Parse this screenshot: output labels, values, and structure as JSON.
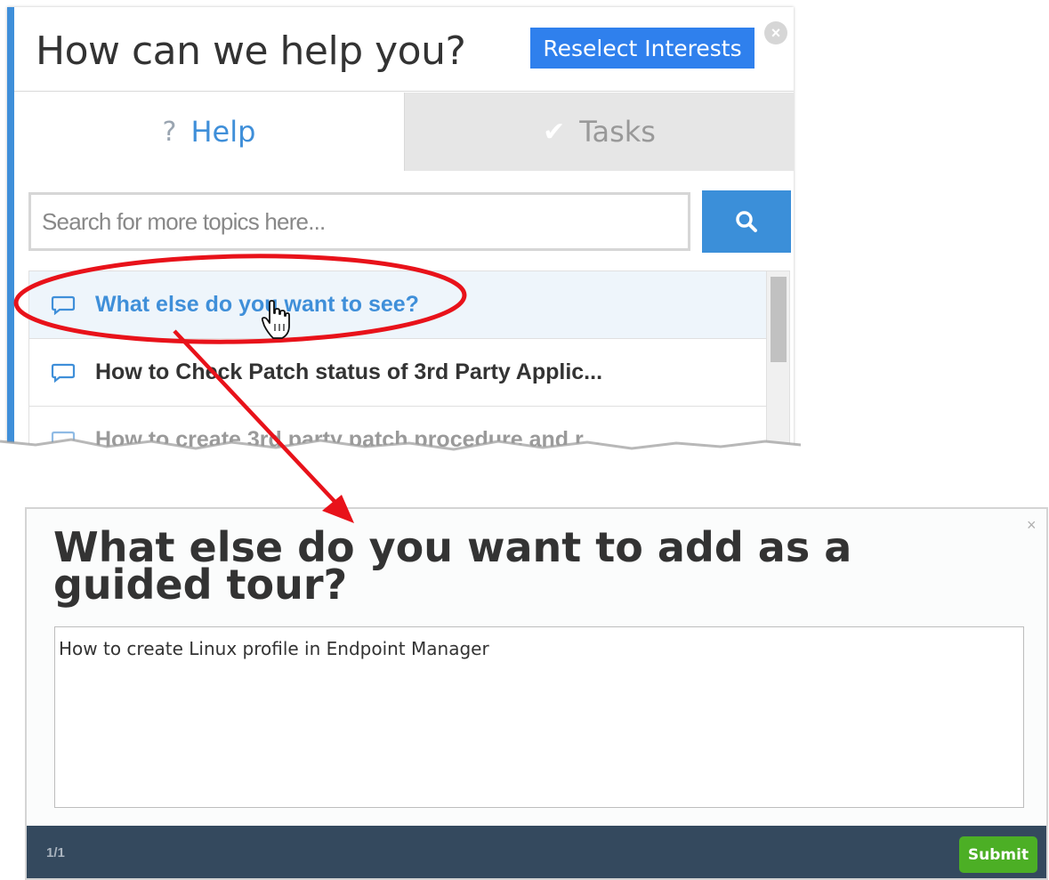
{
  "help_panel": {
    "title": "How can we help you?",
    "reselect_label": "Reselect Interests",
    "close_symbol": "×",
    "tabs": [
      {
        "label": "Help",
        "icon": "?",
        "icon_name": "question-icon",
        "active": true
      },
      {
        "label": "Tasks",
        "icon": "✔",
        "icon_name": "checkmark-icon",
        "active": false
      }
    ],
    "search": {
      "placeholder": "Search for more topics here...",
      "button_icon": "search-icon"
    },
    "topics": [
      {
        "label": "What else do you want to see?",
        "state": "active"
      },
      {
        "label": "How to Check Patch status of 3rd Party Applic...",
        "state": "normal"
      },
      {
        "label": "How to create 3rd party patch procedure and r...",
        "state": "faded"
      }
    ]
  },
  "dialog": {
    "title": "What else do you want to add as a guided tour?",
    "close_symbol": "×",
    "textarea_value": "How to create Linux profile in Endpoint Manager",
    "pager": "1/1",
    "submit_label": "Submit"
  },
  "colors": {
    "accent_blue": "#3f8fd9",
    "button_blue": "#2f80ed",
    "annotation_red": "#e8121a",
    "footer": "#34495e",
    "submit_green": "#4caf25"
  }
}
